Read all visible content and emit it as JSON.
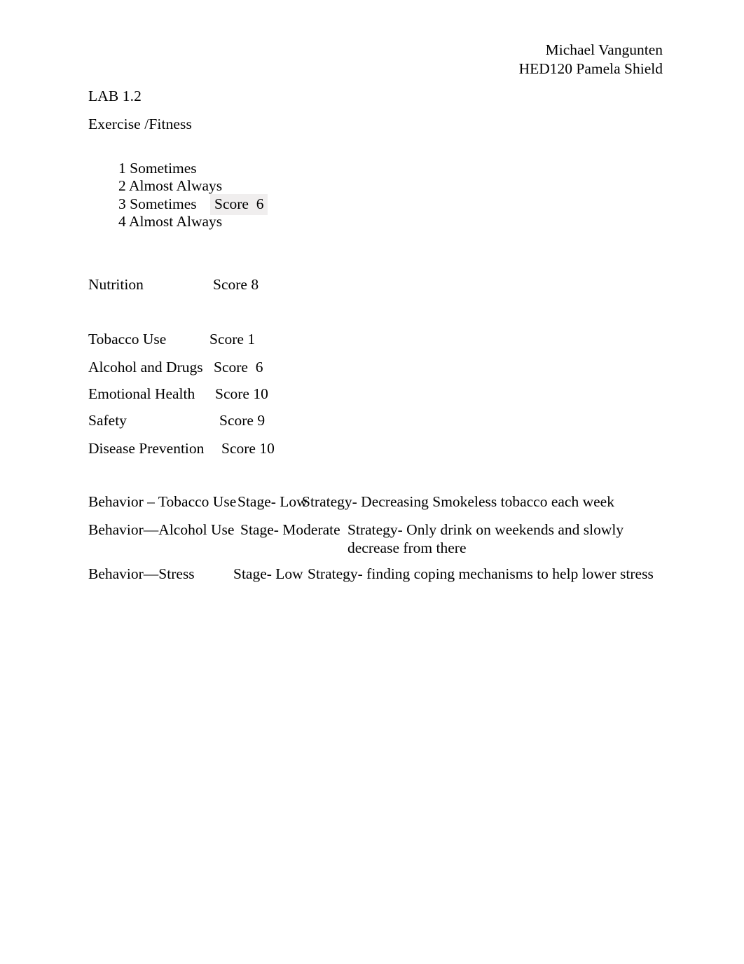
{
  "document": {
    "header": {
      "lines": [
        "Michael Vangunten",
        "HED120 Pamela Shield"
      ]
    },
    "title": "LAB 1.2",
    "section_heading": "Exercise /Fitness",
    "exercise_answers": [
      {
        "text": "1 Sometimes",
        "score_label": ""
      },
      {
        "text": "2 Almost Always",
        "score_label": ""
      },
      {
        "text": "3 Sometimes",
        "score_label": ""
      },
      {
        "text": "4 Almost Always",
        "score_label": "Score  6"
      }
    ],
    "exercise_score_highlight_color": "#f0eeee",
    "score_rows": [
      {
        "label": "Nutrition",
        "score": "Score 8"
      },
      {
        "label": "Tobacco Use",
        "score": "Score 1"
      },
      {
        "label": "Alcohol and Drugs",
        "score": "Score  6"
      },
      {
        "label": "Emotional Health",
        "score": "Score 10"
      },
      {
        "label": "Safety",
        "score": "Score 9"
      },
      {
        "label": "Disease Prevention",
        "score": "Score 10"
      }
    ],
    "behaviors": [
      {
        "behavior": "Behavior – Tobacco Use",
        "stage": "Stage- Low",
        "strategy": "Strategy- Decreasing Smokeless tobacco each week"
      },
      {
        "behavior": "Behavior—Alcohol Use",
        "stage": "Stage- Moderate",
        "strategy": "Strategy- Only drink on weekends and slowly decrease from there"
      },
      {
        "behavior": "Behavior—Stress",
        "stage": "Stage- Low",
        "strategy": "Strategy- finding coping mechanisms to help lower stress"
      }
    ]
  }
}
